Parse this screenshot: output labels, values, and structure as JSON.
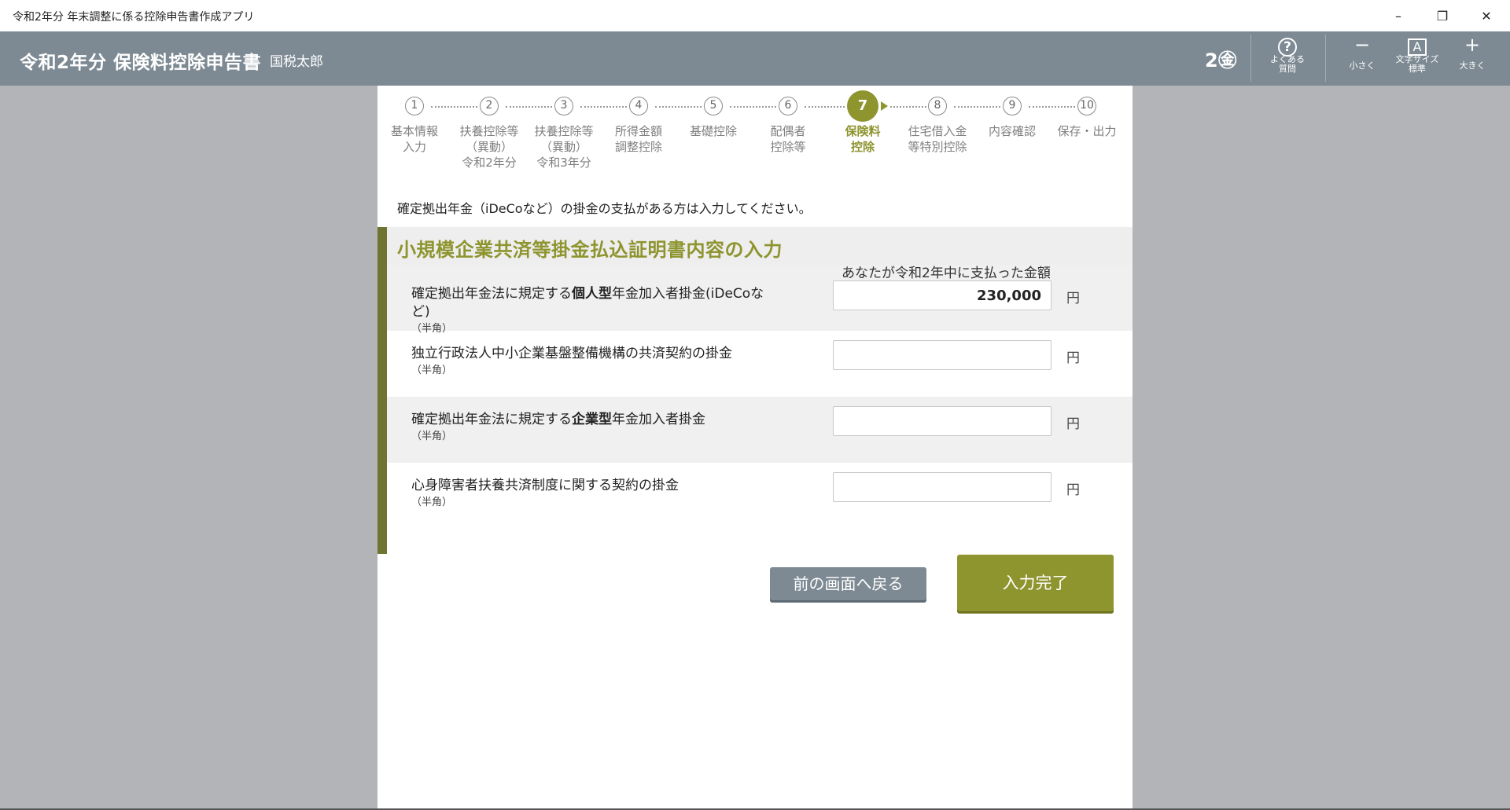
{
  "window": {
    "title": "令和2年分 年末調整に係る控除申告書作成アプリ",
    "minimize": "–",
    "maximize": "❐",
    "close": "✕"
  },
  "header": {
    "app_title": "令和2年分 保険料控除申告書",
    "user_name": "国税太郎",
    "mode_badge": "2㊎",
    "faq_label": "よくある質問",
    "faq_icon": "?",
    "font_smaller_label": "小さく",
    "font_smaller_icon": "−",
    "font_size_label": "文字サイズ標準",
    "font_size_icon": "A",
    "font_larger_label": "大きく",
    "font_larger_icon": "+"
  },
  "steps": [
    {
      "num": "1",
      "label": "基本情報\n入力"
    },
    {
      "num": "2",
      "label": "扶養控除等\n（異動）\n令和2年分"
    },
    {
      "num": "3",
      "label": "扶養控除等\n（異動）\n令和3年分"
    },
    {
      "num": "4",
      "label": "所得金額\n調整控除"
    },
    {
      "num": "5",
      "label": "基礎控除"
    },
    {
      "num": "6",
      "label": "配偶者\n控除等"
    },
    {
      "num": "7",
      "label": "保険料\n控除"
    },
    {
      "num": "8",
      "label": "住宅借入金\n等特別控除"
    },
    {
      "num": "9",
      "label": "内容確認"
    },
    {
      "num": "10",
      "label": "保存・出力"
    }
  ],
  "active_step": 7,
  "instruction": "確定拠出年金（iDeCoなど）の掛金の支払がある方は入力してください。",
  "section": {
    "title": "小規模企業共済等掛金払込証明書内容の入力",
    "amount_header": "あなたが令和2年中に支払った金額",
    "rows": [
      {
        "label_pre": "確定拠出年金法に規定する",
        "label_bold": "個人型",
        "label_post": "年金加入者掛金(iDeCoなど)",
        "note": "（半角）",
        "value": "230,000",
        "unit": "円"
      },
      {
        "label_pre": "独立行政法人中小企業基盤整備機構の共済契約の掛金",
        "label_bold": "",
        "label_post": "",
        "note": "（半角）",
        "value": "",
        "unit": "円"
      },
      {
        "label_pre": "確定拠出年金法に規定する",
        "label_bold": "企業型",
        "label_post": "年金加入者掛金",
        "note": "（半角）",
        "value": "",
        "unit": "円"
      },
      {
        "label_pre": "心身障害者扶養共済制度に関する契約の掛金",
        "label_bold": "",
        "label_post": "",
        "note": "（半角）",
        "value": "",
        "unit": "円"
      }
    ]
  },
  "buttons": {
    "back": "前の画面へ戻る",
    "done": "入力完了"
  }
}
